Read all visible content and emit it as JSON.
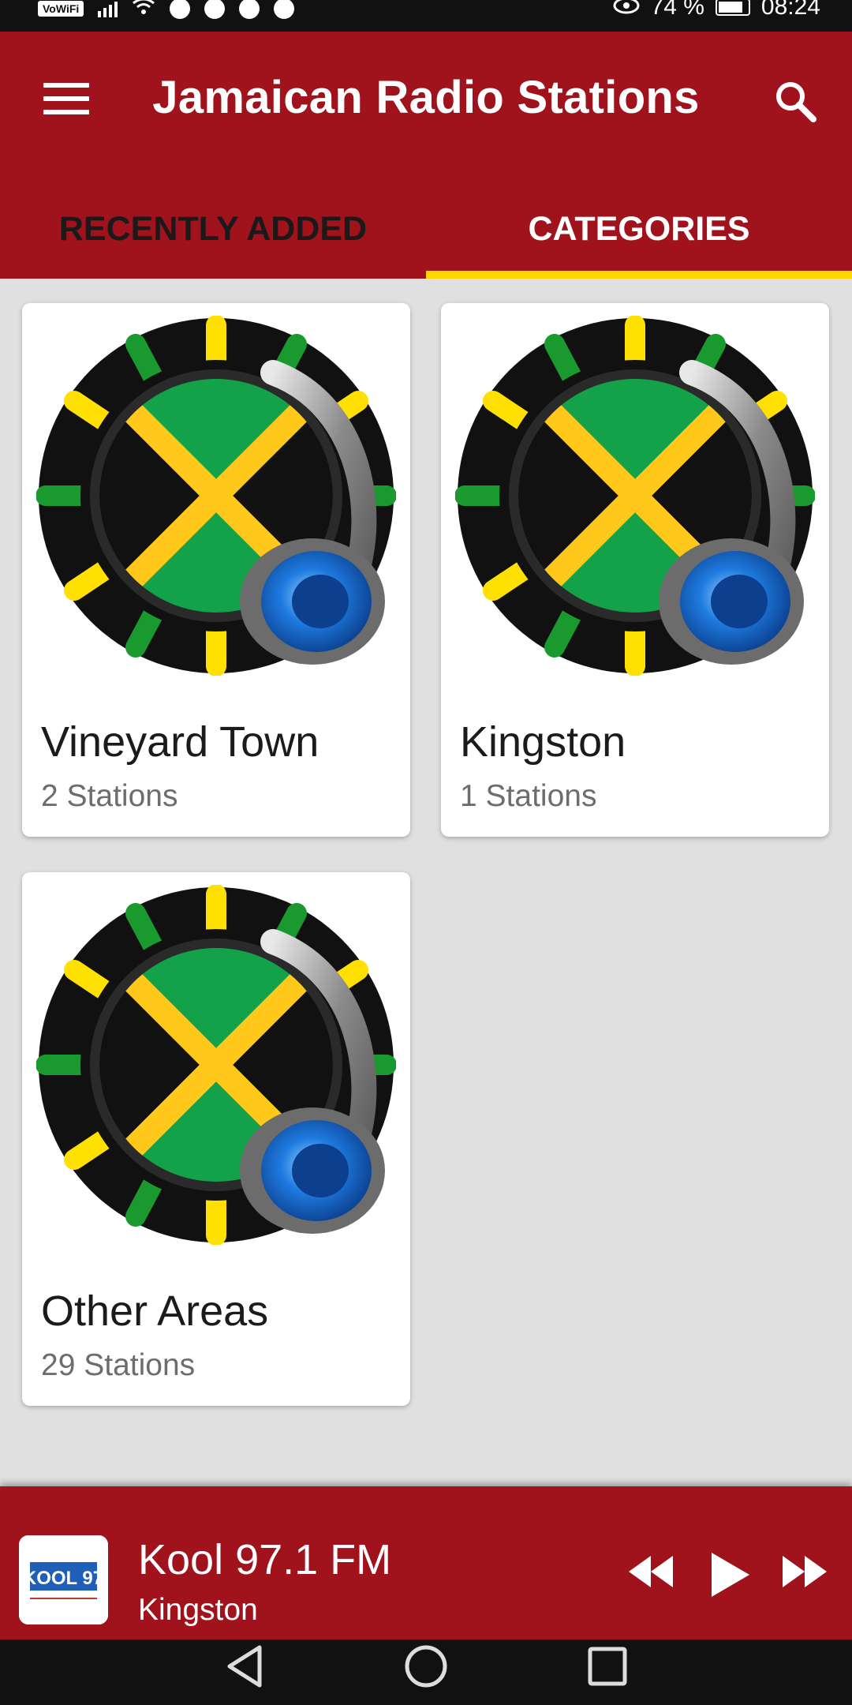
{
  "status_bar": {
    "network_badge": "VoWiFi",
    "battery_percent": "74 %",
    "time": "08:24"
  },
  "app_bar": {
    "title": "Jamaican Radio Stations",
    "menu_icon": "hamburger-menu-icon",
    "search_icon": "search-icon",
    "colors": {
      "primary": "#a0121c",
      "accent": "#ffd600"
    }
  },
  "tabs": [
    {
      "label": "RECENTLY ADDED",
      "active": false
    },
    {
      "label": "CATEGORIES",
      "active": true
    }
  ],
  "categories": [
    {
      "name": "Vineyard Town",
      "count": "2 Stations"
    },
    {
      "name": "Kingston",
      "count": "1 Stations"
    },
    {
      "name": "Other Areas",
      "count": "29 Stations"
    }
  ],
  "player": {
    "title": "Kool 97.1 FM",
    "subtitle": "Kingston",
    "logo_text": "KOOL 97",
    "controls": [
      "rewind-icon",
      "play-icon",
      "fast-forward-icon"
    ]
  },
  "nav_bar": {
    "buttons": [
      "back-icon",
      "home-icon",
      "recents-icon"
    ]
  }
}
